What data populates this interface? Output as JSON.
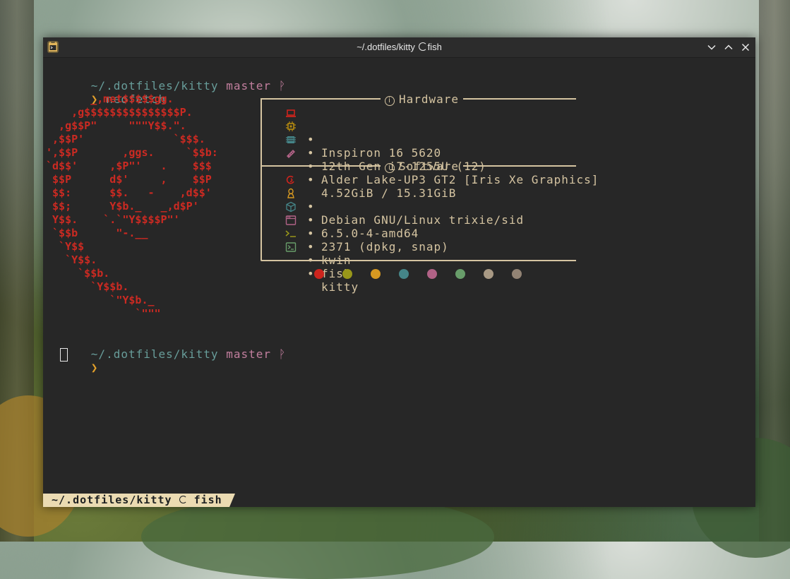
{
  "window": {
    "title_path": "~/.dotfiles/kitty",
    "title_shell": "fish"
  },
  "prompt1": {
    "path": "~/.dotfiles/kitty",
    "branch": "master",
    "branch_glyph": "ᚹ",
    "arrow": "❯",
    "command": "neofetch"
  },
  "prompt2": {
    "path": "~/.dotfiles/kitty",
    "branch": "master",
    "branch_glyph": "ᚹ",
    "arrow": "❯"
  },
  "ascii_art": [
    "       _,met$$$$$gg.",
    "    ,g$$$$$$$$$$$$$$$P.",
    "  ,g$$P\"     \"\"\"Y$$.\".",
    " ,$$P'              `$$$.",
    "',$$P       ,ggs.     `$$b:",
    "`d$$'     ,$P\"'   .    $$$",
    " $$P      d$'     ,    $$P",
    " $$:      $$.   -    ,d$$'",
    " $$;      Y$b._   _,d$P'",
    " Y$$.    `.`\"Y$$$$P\"'",
    " `$$b      \"-.__",
    "  `Y$$",
    "   `Y$$.",
    "     `$$b.",
    "       `Y$$b.",
    "          `\"Y$b._",
    "              `\"\"\""
  ],
  "hardware": {
    "title": "Hardware",
    "items": [
      {
        "icon": "laptop-icon",
        "value": "Inspiron 16 5620"
      },
      {
        "icon": "cpu-icon",
        "value": "12th Gen i7-1255U (12)"
      },
      {
        "icon": "gpu-icon",
        "value": "Alder Lake-UP3 GT2 [Iris Xe Graphics]"
      },
      {
        "icon": "memory-icon",
        "value": "4.52GiB / 15.31GiB"
      }
    ]
  },
  "software": {
    "title": "Software",
    "items": [
      {
        "icon": "debian-icon",
        "value": "Debian GNU/Linux trixie/sid"
      },
      {
        "icon": "linux-icon",
        "value": "6.5.0-4-amd64"
      },
      {
        "icon": "package-icon",
        "value": "2371 (dpkg, snap)"
      },
      {
        "icon": "window-manager-icon",
        "value": "kwin"
      },
      {
        "icon": "shell-icon",
        "value": "fish"
      },
      {
        "icon": "terminal-icon",
        "value": "kitty"
      }
    ]
  },
  "bullet": "•",
  "colors": {
    "swatches": [
      "#cc241d",
      "#98971a",
      "#d79921",
      "#458588",
      "#b16286",
      "#689d6a",
      "#a89984",
      "#928374"
    ],
    "accent": "#d5c4a1",
    "prompt_path": "#689d9a",
    "prompt_branch": "#c27f9e",
    "prompt_arrow": "#e3a02a"
  },
  "statusbar": {
    "path": "~/.dotfiles/kitty",
    "shell": "fish"
  }
}
